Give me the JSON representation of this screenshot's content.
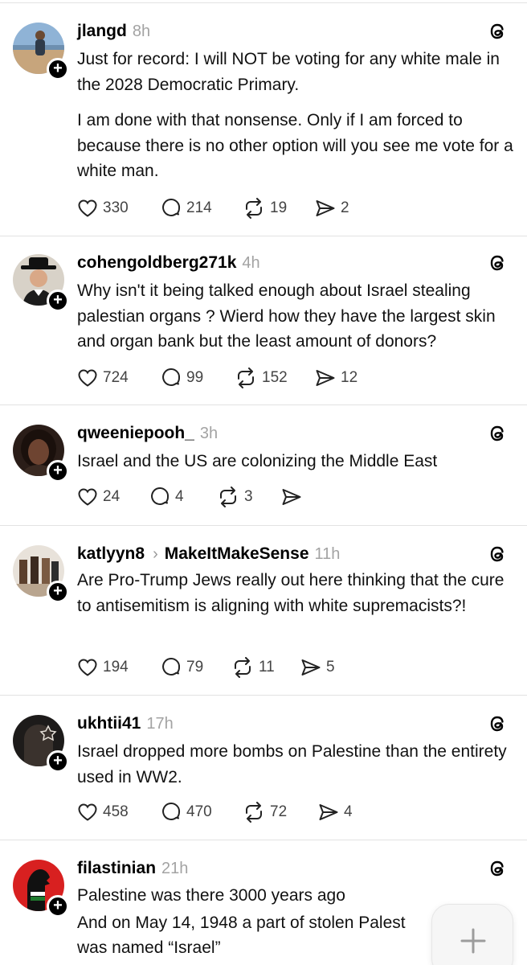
{
  "posts": [
    {
      "username": "jlangd",
      "time": "8h",
      "text": "Just for record: I will NOT be voting for any white male in the 2028 Democratic Primary.",
      "text2": "I am done with that nonsense. Only if I am forced to because there is no other option will you see me vote for a white man.",
      "likes": "330",
      "replies": "214",
      "reposts": "19",
      "shares": "2"
    },
    {
      "username": "cohengoldberg271k",
      "time": "4h",
      "text": "Why isn't it being talked enough about Israel stealing palestian organs ? Wierd how they have the largest skin and organ bank but the least amount of donors?",
      "likes": "724",
      "replies": "99",
      "reposts": "152",
      "shares": "12"
    },
    {
      "username": "qweeniepooh_",
      "time": "3h",
      "text": "Israel and the US are colonizing the Middle East",
      "likes": "24",
      "replies": "4",
      "reposts": "3",
      "shares": ""
    },
    {
      "username": "katlyyn8",
      "community": "MakeItMakeSense",
      "time": "11h",
      "text": "Are Pro-Trump Jews really out here thinking that the cure to antisemitism is aligning with white supremacists?!",
      "likes": "194",
      "replies": "79",
      "reposts": "11",
      "shares": "5"
    },
    {
      "username": "ukhtii41",
      "time": "17h",
      "text": "Israel dropped more bombs on Palestine than the entirety used in WW2.",
      "likes": "458",
      "replies": "470",
      "reposts": "72",
      "shares": "4"
    },
    {
      "username": "filastinian",
      "time": "21h",
      "text": "Palestine was there 3000 years ago",
      "text2": "And on May 14, 1948 a part of stolen Palest",
      "text3": "was named “Israel”"
    }
  ],
  "icons": {
    "like": "heart-icon",
    "reply": "comment-icon",
    "repost": "repost-icon",
    "share": "send-icon",
    "threads": "threads-logo-icon",
    "follow": "plus-icon",
    "compose": "plus-icon"
  },
  "colors": {
    "text": "#111111",
    "muted": "#a3a3a3",
    "divider": "#e2e2e2",
    "follow_badge": "#000000"
  }
}
